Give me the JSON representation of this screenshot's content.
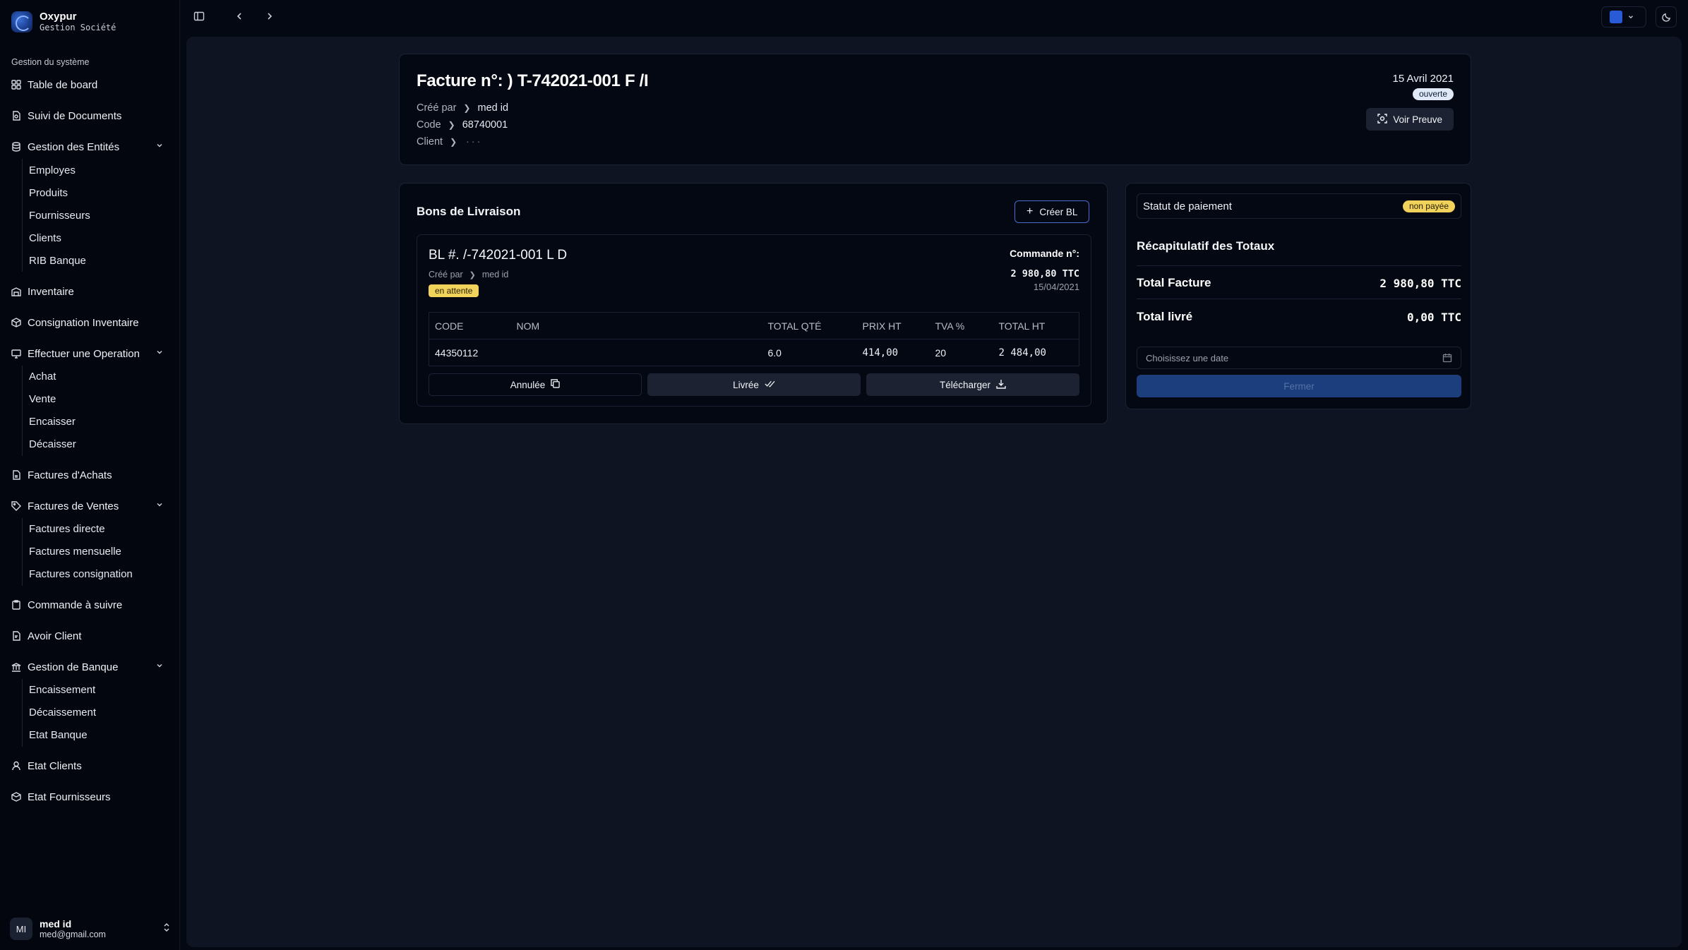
{
  "brand": {
    "name": "Oxypur",
    "subtitle": "Gestion Société"
  },
  "sidebar": {
    "section_label": "Gestion du système",
    "items": {
      "dashboard": "Table de board",
      "documents": "Suivi de Documents",
      "entities": "Gestion des Entités",
      "entities_sub": [
        "Employes",
        "Produits",
        "Fournisseurs",
        "Clients",
        "RIB Banque"
      ],
      "inventory": "Inventaire",
      "consignment": "Consignation Inventaire",
      "operation": "Effectuer une Operation",
      "operation_sub": [
        "Achat",
        "Vente",
        "Encaisser",
        "Décaisser"
      ],
      "purchase_invoices": "Factures d'Achats",
      "sales_invoices": "Factures de Ventes",
      "sales_sub": [
        "Factures directe",
        "Factures mensuelle",
        "Factures consignation"
      ],
      "orders": "Commande à suivre",
      "credit": "Avoir Client",
      "bank": "Gestion de Banque",
      "bank_sub": [
        "Encaissement",
        "Décaissement",
        "Etat Banque"
      ],
      "clients_state": "Etat Clients",
      "suppliers_state": "Etat Fournisseurs"
    }
  },
  "user": {
    "initials": "MI",
    "name": "med id",
    "email": "med@gmail.com"
  },
  "theme": {
    "accent_color": "#2a5bd7"
  },
  "invoice": {
    "title": "Facture n°: )    T-742021-001 F    /I",
    "created_by_label": "Créé par",
    "created_by": "med id",
    "code_label": "Code",
    "code": "68740001",
    "client_label": "Client",
    "client": " · · ·",
    "date": "15 Avril 2021",
    "status": "ouverte",
    "proof_button": "Voir Preuve"
  },
  "deliveries": {
    "heading": "Bons de Livraison",
    "create_button": "Créer BL",
    "bl": {
      "title": "BL #.  /-742021-001 L   D",
      "created_by_label": "Créé par",
      "created_by": "med id",
      "status": "en attente",
      "order_label": "Commande n°:",
      "order_amount": "2 980,80 TTC",
      "order_date": "15/04/2021",
      "columns": [
        "CODE",
        "NOM",
        "TOTAL QTÉ",
        "PRIX HT",
        "TVA %",
        "TOTAL HT"
      ],
      "rows": [
        {
          "code": "44350112",
          "nom": "",
          "qty": "6.0",
          "prix_ht": "414,00",
          "tva": "20",
          "total_ht": "2 484,00"
        }
      ],
      "btn_cancel": "Annulée",
      "btn_delivered": "Livrée",
      "btn_download": "Télécharger"
    }
  },
  "payment": {
    "status_label": "Statut de paiement",
    "status": "non payée",
    "recap_title": "Récapitulatif des Totaux",
    "total_invoice_label": "Total Facture",
    "total_invoice": "2 980,80 TTC",
    "total_delivered_label": "Total livré",
    "total_delivered": "0,00 TTC",
    "date_placeholder": "Choisissez une date",
    "close_button": "Fermer"
  }
}
